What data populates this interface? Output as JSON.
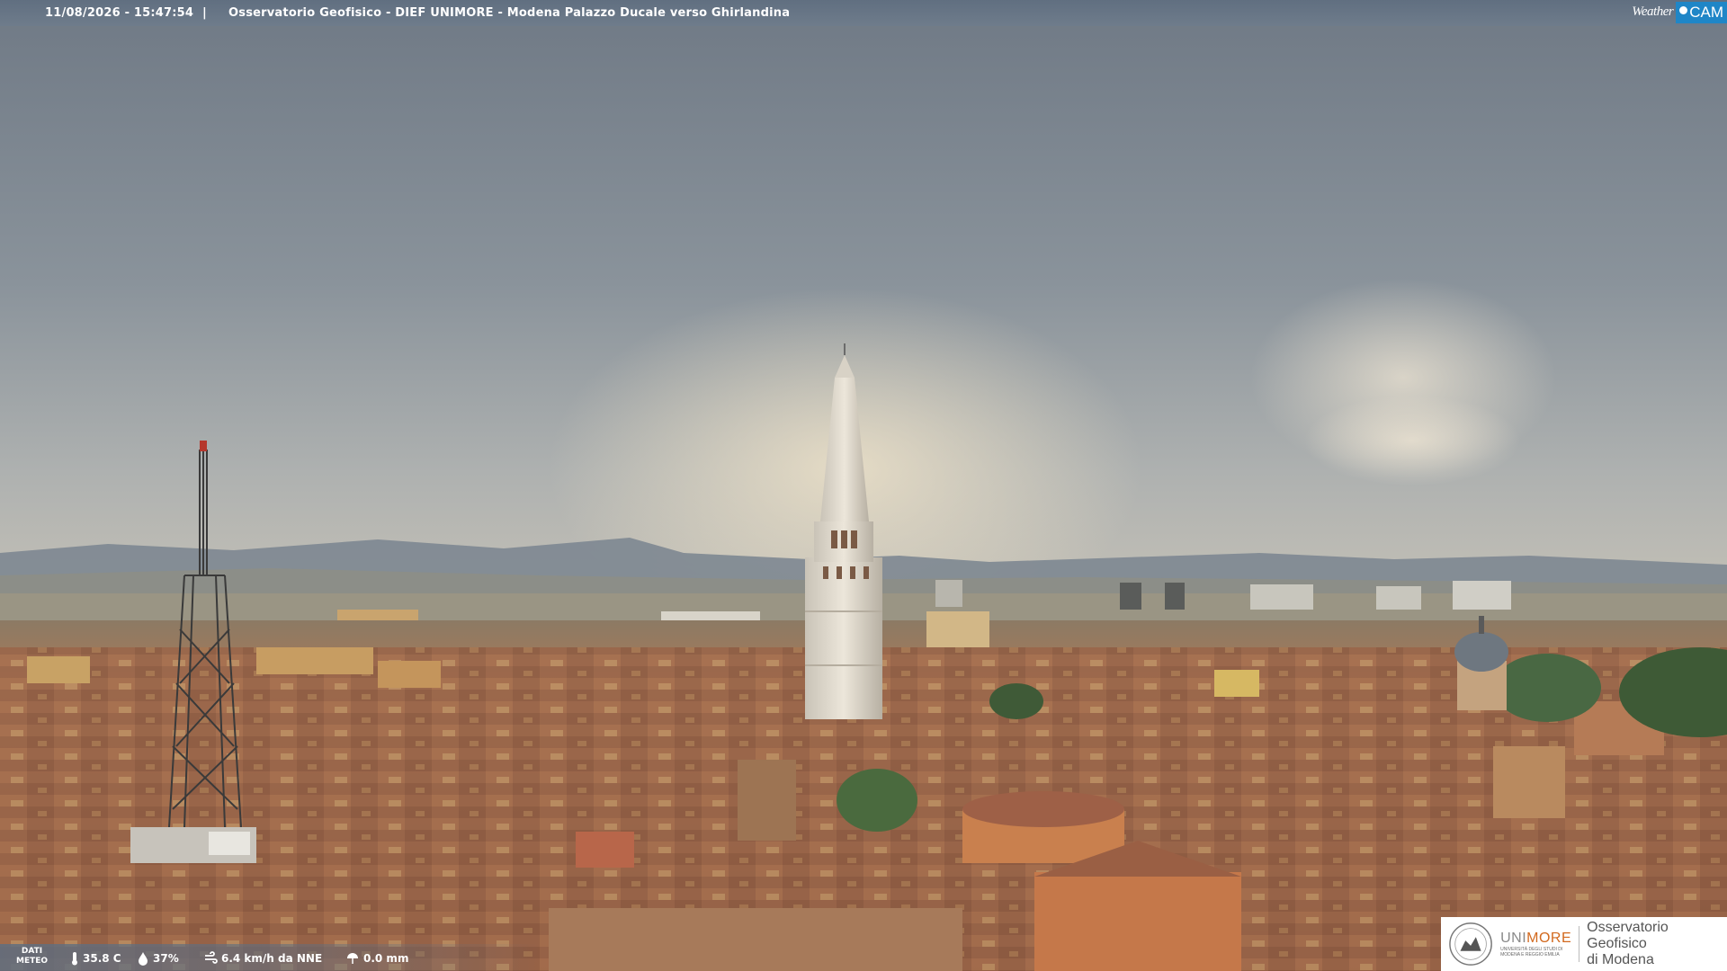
{
  "header": {
    "timestamp": "11/08/2026 - 15:47:54",
    "separator": "|",
    "title": "Osservatorio Geofisico - DIEF UNIMORE - Modena Palazzo Ducale verso Ghirlandina"
  },
  "brand": {
    "weather": "Weather",
    "cam": "CAM"
  },
  "weather_bar": {
    "label_line1": "DATI",
    "label_line2": "METEO",
    "temperature": "35.8 C",
    "humidity": "37%",
    "wind": "6.4 km/h da NNE",
    "rain": "0.0 mm"
  },
  "logo": {
    "uni": "UNI",
    "more": "MORE",
    "sub_line1": "UNIVERSITÀ DEGLI STUDI DI",
    "sub_line2": "MODENA E REGGIO EMILIA",
    "obs_line1": "Osservatorio Geofisico",
    "obs_line2": "di Modena"
  },
  "colors": {
    "sky_top": "#6d7885",
    "sky_glow": "#d9cdb8",
    "roofs": "#9b6a4e",
    "tower": "#e3ddd0",
    "cam_blue": "#1f86c7",
    "unimore_orange": "#d2691e"
  }
}
